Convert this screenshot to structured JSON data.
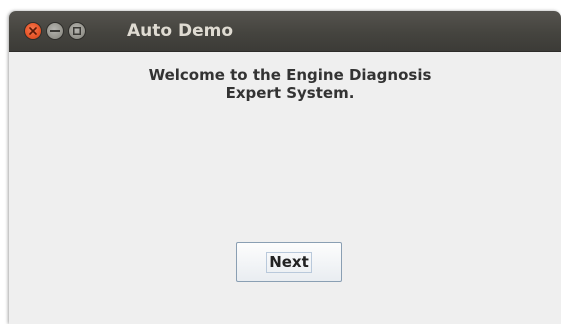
{
  "window": {
    "title": "Auto Demo",
    "controls": [
      "close-icon",
      "minimize-icon",
      "maximize-icon"
    ]
  },
  "main": {
    "welcome_line1": "Welcome to the Engine Diagnosis",
    "welcome_line2": "Expert System.",
    "next_label": "Next"
  },
  "colors": {
    "titlebar": "#45443f",
    "close_button": "#e9572a",
    "background": "#efefef"
  }
}
